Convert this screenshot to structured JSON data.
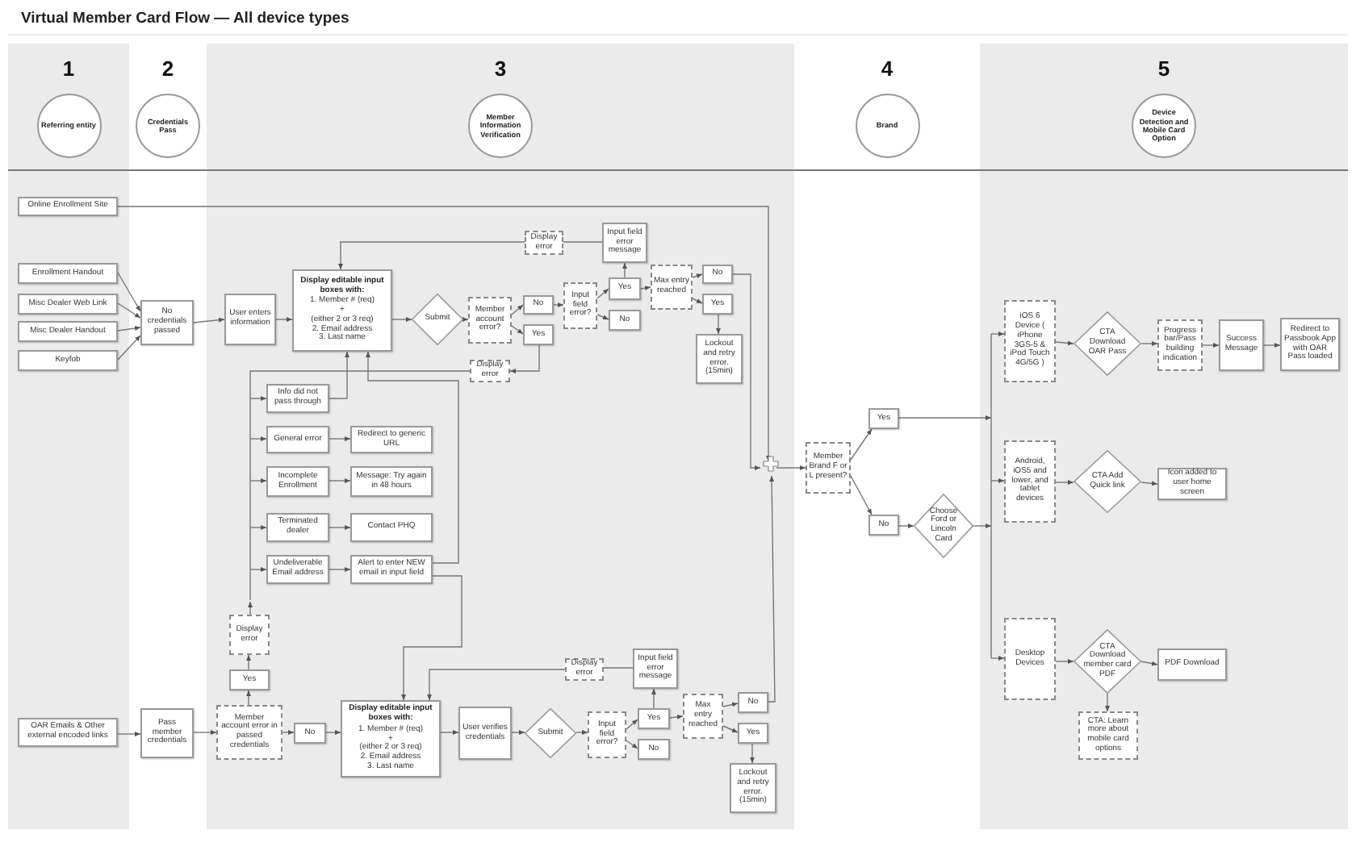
{
  "title": "Virtual Member Card Flow — All device types",
  "lanes": [
    {
      "number": "1",
      "label": "Referring entity"
    },
    {
      "number": "2",
      "label": "Credentials Pass"
    },
    {
      "number": "3",
      "label": "Member Information Verification"
    },
    {
      "number": "4",
      "label": "Brand"
    },
    {
      "number": "5",
      "label": "Device Detection and Mobile Card Option"
    }
  ],
  "nodes": [
    {
      "kind": "box",
      "text": "Online Enrollment Site"
    },
    {
      "kind": "box",
      "text": "Enrollment Handout"
    },
    {
      "kind": "box",
      "text": "Misc Dealer Web Link"
    },
    {
      "kind": "box",
      "text": "Misc Dealer Handout"
    },
    {
      "kind": "box",
      "text": "Keyfob"
    },
    {
      "kind": "box",
      "text": "No credentials passed"
    },
    {
      "kind": "box",
      "text": "User enters information"
    },
    {
      "kind": "form",
      "heading": "Display editable input boxes with:",
      "lines": [
        "1. Member # (req)",
        "+",
        "(either 2 or 3 req)",
        "2. Email address",
        "3. Last name"
      ]
    },
    {
      "kind": "diamond",
      "text": "Submit"
    },
    {
      "kind": "dashed",
      "text": "Display error"
    },
    {
      "kind": "box",
      "text": "Input field error message"
    },
    {
      "kind": "dashed",
      "text": "Member account error?"
    },
    {
      "kind": "box",
      "text": "No"
    },
    {
      "kind": "box",
      "text": "Yes"
    },
    {
      "kind": "dashed",
      "text": "Display error"
    },
    {
      "kind": "dashed",
      "text": "Input field error?"
    },
    {
      "kind": "box",
      "text": "Yes"
    },
    {
      "kind": "box",
      "text": "No"
    },
    {
      "kind": "dashed",
      "text": "Max entry reached"
    },
    {
      "kind": "box",
      "text": "No"
    },
    {
      "kind": "box",
      "text": "Yes"
    },
    {
      "kind": "box",
      "text": "Lockout and retry error. (15min)"
    },
    {
      "kind": "box",
      "text": "Info did not pass through"
    },
    {
      "kind": "box",
      "text": "General error"
    },
    {
      "kind": "box",
      "text": "Redirect to generic URL"
    },
    {
      "kind": "box",
      "text": "Incomplete Enrollment"
    },
    {
      "kind": "box",
      "text": "Message: Try again in 48 hours"
    },
    {
      "kind": "box",
      "text": "Terminated dealer"
    },
    {
      "kind": "box",
      "text": "Contact PHQ"
    },
    {
      "kind": "box",
      "text": "Undeliverable Email address"
    },
    {
      "kind": "box",
      "text": "Alert to enter NEW email in input field"
    },
    {
      "kind": "dashed",
      "text": "Member Brand F or L present?"
    },
    {
      "kind": "box",
      "text": "Yes"
    },
    {
      "kind": "box",
      "text": "No"
    },
    {
      "kind": "diamond",
      "text": "Choose Ford or Lincoln Card"
    },
    {
      "kind": "dashed",
      "text": "iOS 6 Device ( iPhone 3GS-5 & iPod Touch 4G/5G )"
    },
    {
      "kind": "diamond",
      "text": "CTA Download OAR Pass"
    },
    {
      "kind": "dashed",
      "text": "Progress bar/Pass building indication"
    },
    {
      "kind": "box",
      "text": "Success Message"
    },
    {
      "kind": "box",
      "text": "Redirect to Passbook App with OAR Pass loaded"
    },
    {
      "kind": "dashed",
      "text": "Android, iOS5 and lower, and tablet devices"
    },
    {
      "kind": "diamond",
      "text": "CTA Add Quick link"
    },
    {
      "kind": "box",
      "text": "Icon added to user home screen"
    },
    {
      "kind": "dashed",
      "text": "Desktop Devices"
    },
    {
      "kind": "diamond",
      "text": "CTA Download member card PDF"
    },
    {
      "kind": "box",
      "text": "PDF Download"
    },
    {
      "kind": "dashed",
      "text": "CTA: Learn more about mobile card options"
    },
    {
      "kind": "dashed",
      "text": "Display error"
    },
    {
      "kind": "box",
      "text": "Yes"
    },
    {
      "kind": "box",
      "text": "OAR Emails & Other external encoded links"
    },
    {
      "kind": "box",
      "text": "Pass member credentials"
    },
    {
      "kind": "dashed",
      "text": "Member account error in passed credentials"
    },
    {
      "kind": "box",
      "text": "No"
    },
    {
      "kind": "form",
      "heading": "Display editable input boxes with:",
      "lines": [
        "1. Member # (req)",
        "+",
        "(either 2 or 3 req)",
        "2. Email address",
        "3. Last name"
      ]
    },
    {
      "kind": "box",
      "text": "User verifies credentials"
    },
    {
      "kind": "diamond",
      "text": "Submit"
    },
    {
      "kind": "dashed",
      "text": "Display error"
    },
    {
      "kind": "box",
      "text": "Input field error message"
    },
    {
      "kind": "dashed",
      "text": "Input field error?"
    },
    {
      "kind": "box",
      "text": "Yes"
    },
    {
      "kind": "box",
      "text": "No"
    },
    {
      "kind": "dashed",
      "text": "Max entry reached"
    },
    {
      "kind": "box",
      "text": "No"
    },
    {
      "kind": "box",
      "text": "Yes"
    },
    {
      "kind": "box",
      "text": "Lockout and retry error. (15min)"
    }
  ]
}
